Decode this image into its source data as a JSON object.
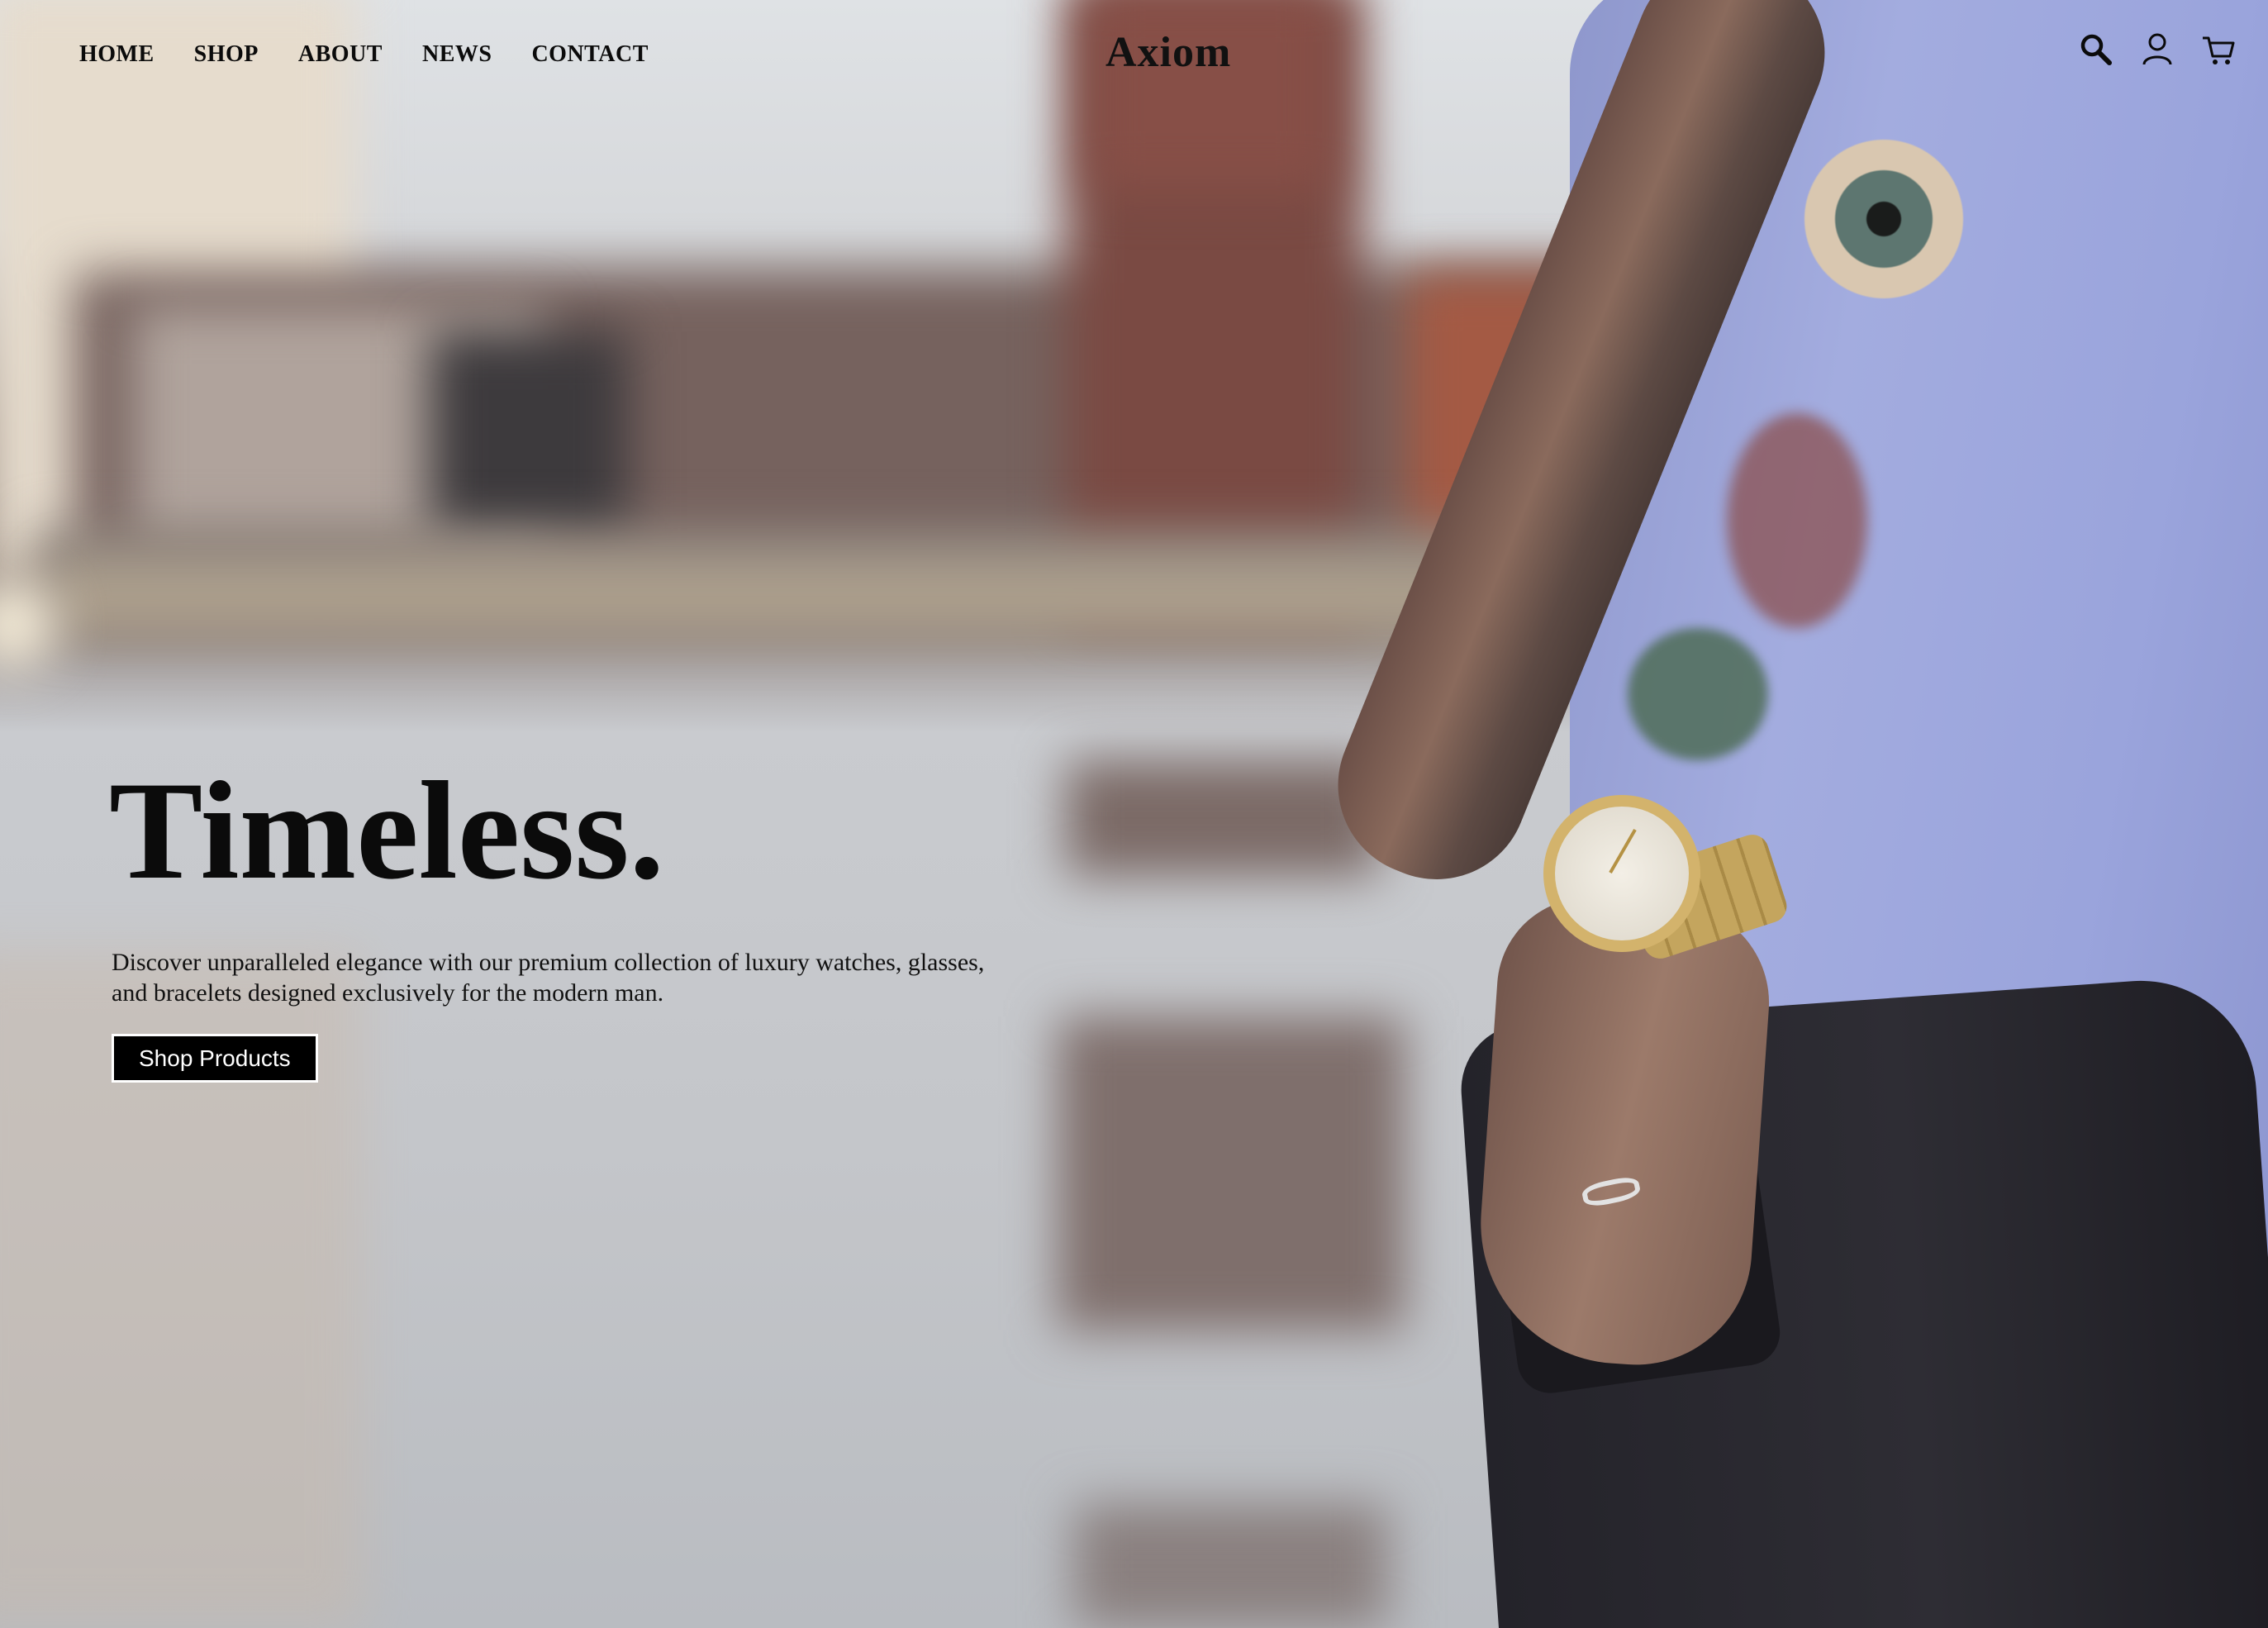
{
  "nav": {
    "items": [
      {
        "label": "HOME"
      },
      {
        "label": "SHOP"
      },
      {
        "label": "ABOUT"
      },
      {
        "label": "NEWS"
      },
      {
        "label": "CONTACT"
      }
    ]
  },
  "brand": {
    "name": "Axiom"
  },
  "header_icons": {
    "search": "search-icon",
    "account": "user-icon",
    "cart": "cart-icon"
  },
  "hero": {
    "headline": "Timeless.",
    "description": "Discover unparalleled elegance with our premium collection of luxury watches, glasses, and bracelets designed exclusively for the modern man.",
    "cta_label": "Shop Products",
    "image": "man-in-blue-shirt-wearing-gold-watch"
  },
  "colors": {
    "text": "#0b0b0b",
    "button_bg": "#000000",
    "button_text": "#ffffff"
  }
}
